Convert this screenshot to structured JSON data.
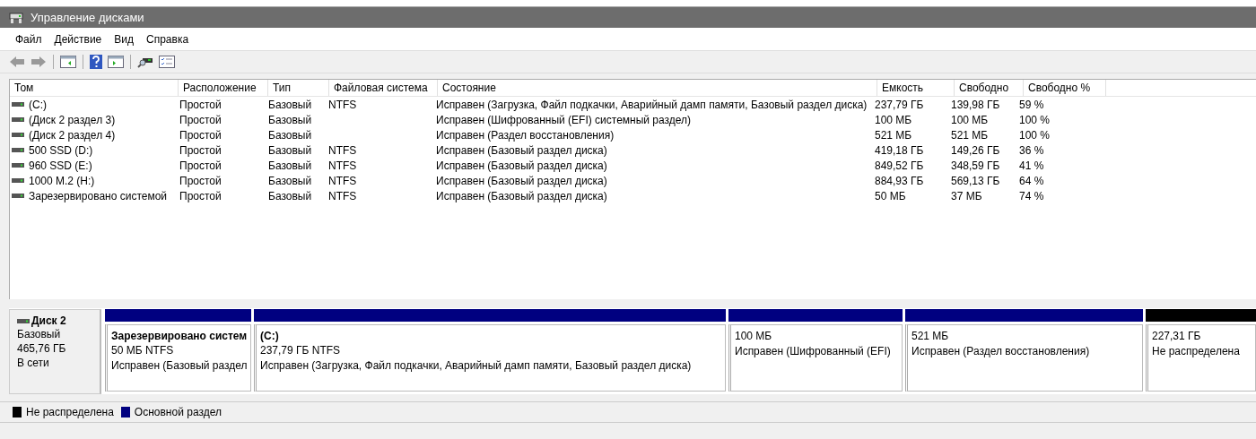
{
  "window": {
    "title": "Управление дисками"
  },
  "menu": [
    "Файл",
    "Действие",
    "Вид",
    "Справка"
  ],
  "table": {
    "columns": [
      "Том",
      "Расположение",
      "Тип",
      "Файловая система",
      "Состояние",
      "Емкость",
      "Свободно",
      "Свободно %"
    ],
    "rows": [
      [
        "(C:)",
        "Простой",
        "Базовый",
        "NTFS",
        "Исправен (Загрузка, Файл подкачки, Аварийный дамп памяти, Базовый раздел диска)",
        "237,79 ГБ",
        "139,98 ГБ",
        "59 %"
      ],
      [
        "(Диск 2 раздел 3)",
        "Простой",
        "Базовый",
        "",
        "Исправен (Шифрованный (EFI) системный раздел)",
        "100 МБ",
        "100 МБ",
        "100 %"
      ],
      [
        "(Диск 2 раздел 4)",
        "Простой",
        "Базовый",
        "",
        "Исправен (Раздел восстановления)",
        "521 МБ",
        "521 МБ",
        "100 %"
      ],
      [
        "500 SSD (D:)",
        "Простой",
        "Базовый",
        "NTFS",
        "Исправен (Базовый раздел диска)",
        "419,18 ГБ",
        "149,26 ГБ",
        "36 %"
      ],
      [
        "960 SSD (E:)",
        "Простой",
        "Базовый",
        "NTFS",
        "Исправен (Базовый раздел диска)",
        "849,52 ГБ",
        "348,59 ГБ",
        "41 %"
      ],
      [
        "1000 M.2 (H:)",
        "Простой",
        "Базовый",
        "NTFS",
        "Исправен (Базовый раздел диска)",
        "884,93 ГБ",
        "569,13 ГБ",
        "64 %"
      ],
      [
        "Зарезервировано системой",
        "Простой",
        "Базовый",
        "NTFS",
        "Исправен (Базовый раздел диска)",
        "50 МБ",
        "37 МБ",
        "74 %"
      ]
    ]
  },
  "disk": {
    "name": "Диск 2",
    "type": "Базовый",
    "size": "465,76 ГБ",
    "status": "В сети",
    "partitions": [
      {
        "name": "Зарезервировано систем",
        "size": "50 МБ NTFS",
        "status": "Исправен (Базовый раздел",
        "color": "#000080"
      },
      {
        "name": "(C:)",
        "size": "237,79 ГБ NTFS",
        "status": "Исправен (Загрузка, Файл подкачки, Аварийный дамп памяти, Базовый раздел диска)",
        "color": "#000080"
      },
      {
        "size": "100 МБ",
        "status": "Исправен (Шифрованный (EFI)",
        "color": "#000080"
      },
      {
        "size": "521 МБ",
        "status": "Исправен (Раздел восстановления)",
        "color": "#000080"
      },
      {
        "size": "227,31 ГБ",
        "status": "Не распределена",
        "color": "#000000"
      }
    ]
  },
  "legend": [
    {
      "label": "Не распределена",
      "color": "#000000"
    },
    {
      "label": "Основной раздел",
      "color": "#000080"
    }
  ]
}
